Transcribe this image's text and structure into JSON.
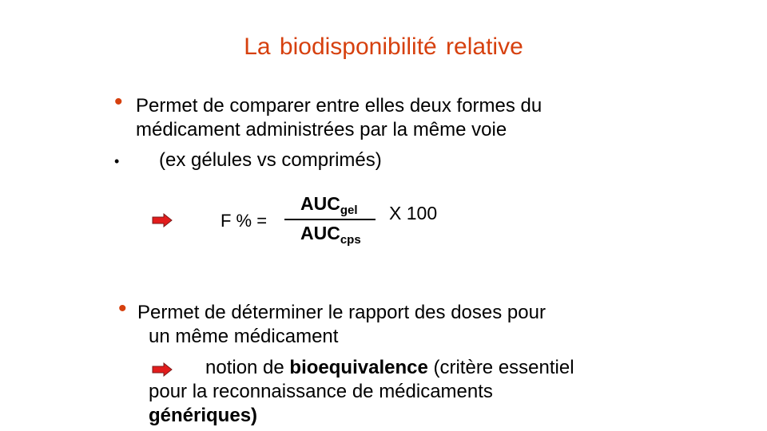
{
  "slide": {
    "title": "La biodisponibilité relative",
    "bullet1": {
      "line1": "Permet de comparer entre elles deux formes du",
      "line2": "médicament administrées par la même voie"
    },
    "bullet2": "(ex gélules vs comprimés)",
    "formula": {
      "lhs": "F % =",
      "numerator": "AUC",
      "numerator_sub": "gel",
      "denominator": "AUC",
      "denominator_sub": "cps",
      "multiplier": "X 100"
    },
    "bullet3": {
      "line1": "Permet de déterminer le rapport des doses pour",
      "line2": "un même médicament",
      "line3_pre": "notion de ",
      "line3_bold": "bioequivalence",
      "line3_post": " (critère essentiel",
      "line4": "pour la reconnaissance de médicaments",
      "line5_bold": "génériques)"
    },
    "colors": {
      "title": "#d6400e",
      "bullet": "#d6400e",
      "arrow_fill": "#e21c1c"
    },
    "icons": [
      "bullet-dot-icon",
      "right-arrow-icon"
    ]
  }
}
